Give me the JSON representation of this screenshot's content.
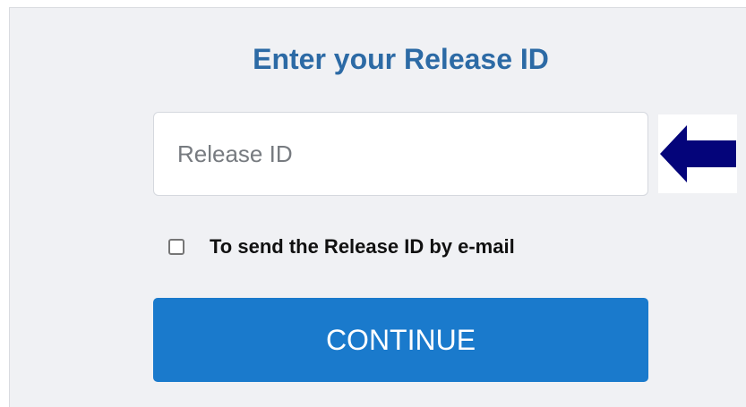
{
  "form": {
    "title": "Enter your Release ID",
    "release_id_placeholder": "Release ID",
    "release_id_value": "",
    "email_checkbox_label": "To send the Release ID by e-mail",
    "email_checkbox_checked": false,
    "continue_label": "CONTINUE"
  },
  "icons": {
    "arrow": "arrow-left-icon"
  },
  "colors": {
    "title": "#2c6aa5",
    "button": "#1a7acc",
    "arrow": "#04047a",
    "panel_background": "#f0f1f4"
  }
}
